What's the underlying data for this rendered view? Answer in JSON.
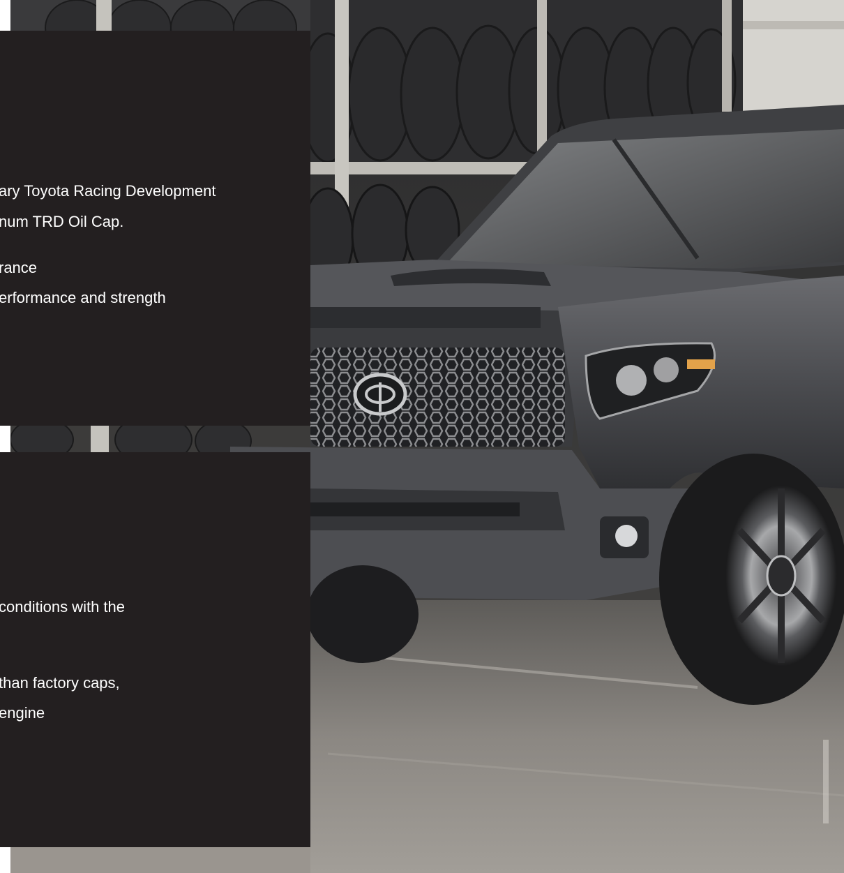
{
  "hero_image": {
    "subject": "truck-in-tire-warehouse",
    "colors": {
      "panel": "#231f20",
      "truck_body": "#4a4b4e",
      "grille": "#2c2d30",
      "floor": "#8a8681",
      "tires": "#2b2b2d",
      "rack": "#c8c6c0"
    }
  },
  "top_panel": {
    "lines": [
      "ary Toyota Racing Development",
      "num TRD Oil Cap.",
      "rance",
      "erformance and strength"
    ]
  },
  "bottom_panel": {
    "lines": [
      "conditions with the",
      "than factory caps,",
      " engine"
    ]
  }
}
